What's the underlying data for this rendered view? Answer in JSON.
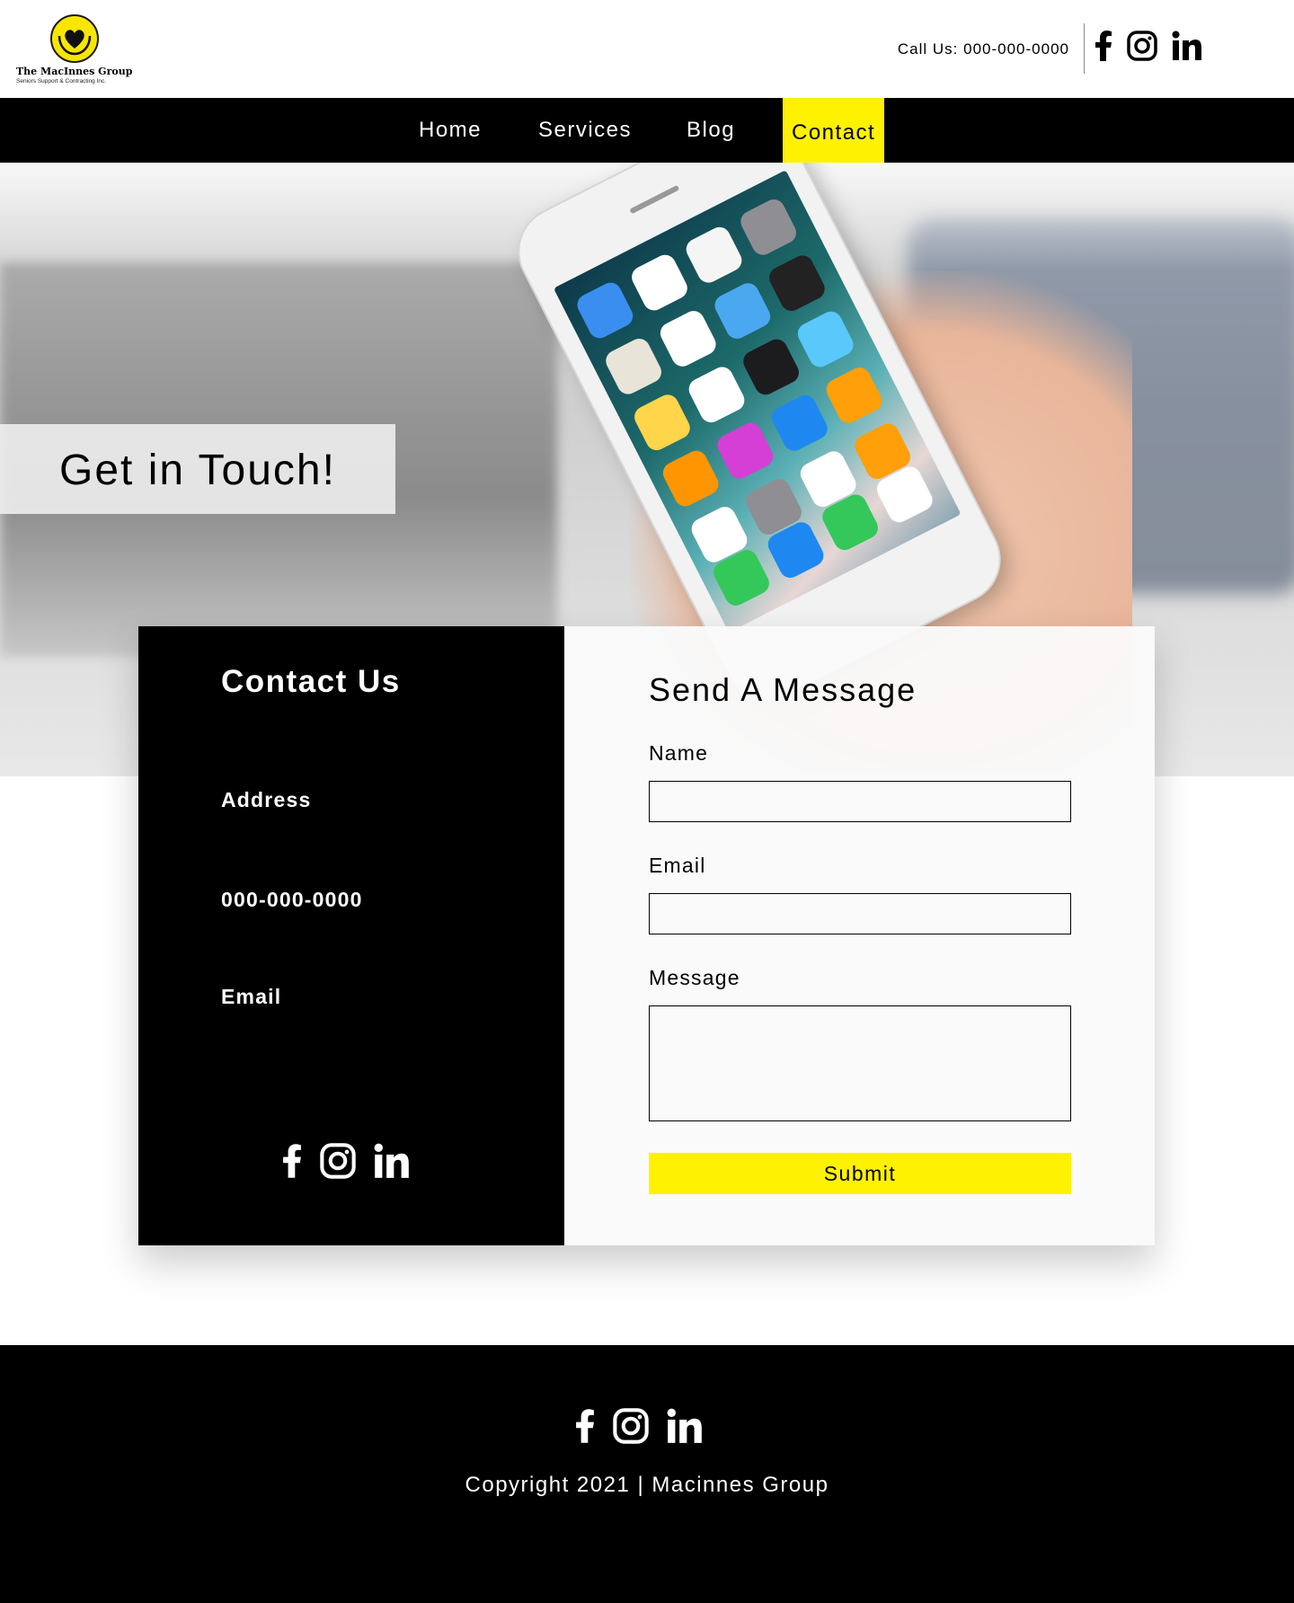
{
  "brand": {
    "name": "The MacInnes Group",
    "tagline": "Seniors Support & Contracting Inc.",
    "accent_color": "#fff200"
  },
  "header": {
    "call_text": "Call Us: 000-000-0000",
    "social_icons": [
      "facebook-icon",
      "instagram-icon",
      "linkedin-icon"
    ]
  },
  "nav": {
    "items": [
      {
        "label": "Home",
        "active": false
      },
      {
        "label": "Services",
        "active": false
      },
      {
        "label": "Blog",
        "active": false
      },
      {
        "label": "Contact",
        "active": true
      }
    ]
  },
  "hero": {
    "title": "Get in Touch!"
  },
  "contact_info": {
    "title": "Contact Us",
    "address_label": "Address",
    "phone": "000-000-0000",
    "email_label": "Email"
  },
  "form": {
    "title": "Send A Message",
    "name_label": "Name",
    "name_value": "",
    "email_label": "Email",
    "email_value": "",
    "message_label": "Message",
    "message_value": "",
    "submit_label": "Submit"
  },
  "footer": {
    "copyright": "Copyright 2021 | Macinnes Group"
  }
}
